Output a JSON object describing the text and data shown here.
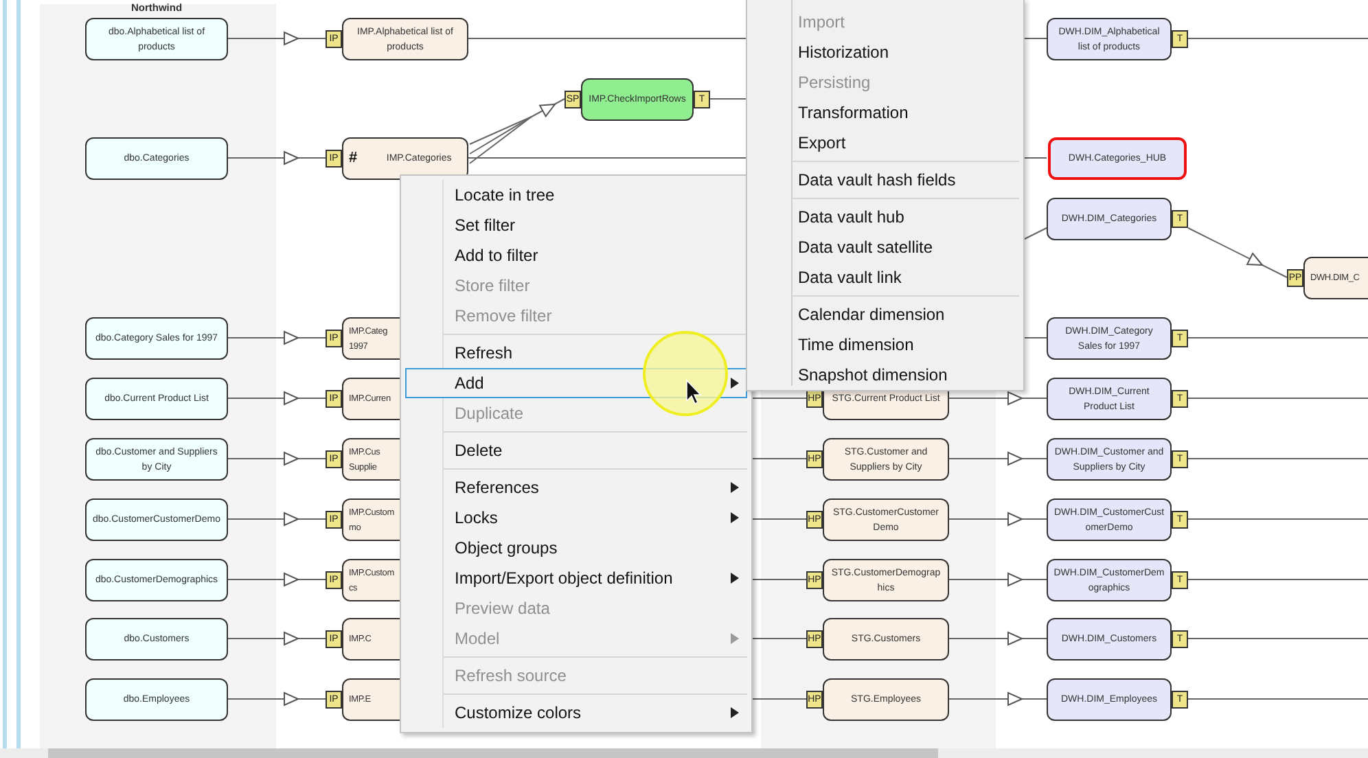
{
  "diagram": {
    "group_label": "Northwind",
    "rows": [
      {
        "source": {
          "label": "dbo.Alphabetical list of products"
        },
        "import": {
          "badge": "IP",
          "label": "IMP.Alphabetical list of products"
        },
        "dwh": {
          "label": "DWH.DIM_Alphabetical list of products",
          "badge": "T",
          "highlighted": false
        }
      },
      {
        "source": {
          "label": "dbo.Categories"
        },
        "import": {
          "badge": "IP",
          "prefix": "#",
          "label": "IMP.Categories"
        },
        "dwh": {
          "label": "DWH.Categories_HUB",
          "highlighted": true
        }
      },
      {
        "dwh": {
          "label": "DWH.DIM_Categories",
          "badge": "T",
          "highlighted": false
        }
      },
      {
        "source": {
          "label": "dbo.Category Sales for 1997"
        },
        "import": {
          "badge": "IP",
          "label": "IMP.Categ\n1997"
        },
        "dwh": {
          "label": "DWH.DIM_Category Sales for 1997",
          "badge": "T",
          "highlighted": false
        }
      },
      {
        "source": {
          "label": "dbo.Current Product List"
        },
        "import": {
          "badge": "IP",
          "label": "IMP.Curren"
        },
        "stage": {
          "badge": "HP",
          "label": "STG.Current Product List"
        },
        "dwh": {
          "label": "DWH.DIM_Current Product List",
          "badge": "T",
          "highlighted": false
        }
      },
      {
        "source": {
          "label": "dbo.Customer and Suppliers by City"
        },
        "import": {
          "badge": "IP",
          "label": "IMP.Cus\nSupplie"
        },
        "stage": {
          "badge": "HP",
          "label": "STG.Customer and Suppliers by City"
        },
        "dwh": {
          "label": "DWH.DIM_Customer and Suppliers by City",
          "badge": "T",
          "highlighted": false
        }
      },
      {
        "source": {
          "label": "dbo.CustomerCustomerDemo"
        },
        "import": {
          "badge": "IP",
          "label": "IMP.Custom\nmo"
        },
        "stage": {
          "badge": "HP",
          "label": "STG.CustomerCustomerDemo"
        },
        "dwh": {
          "label": "DWH.DIM_CustomerCustomerDemo",
          "badge": "T",
          "highlighted": false
        }
      },
      {
        "source": {
          "label": "dbo.CustomerDemographics"
        },
        "import": {
          "badge": "IP",
          "label": "IMP.Custom\ncs"
        },
        "stage": {
          "badge": "HP",
          "label": "STG.CustomerDemographics"
        },
        "dwh": {
          "label": "DWH.DIM_CustomerDemographics",
          "badge": "T",
          "highlighted": false
        }
      },
      {
        "source": {
          "label": "dbo.Customers"
        },
        "import": {
          "badge": "IP",
          "label": "IMP.C"
        },
        "stage": {
          "badge": "HP",
          "label": "STG.Customers"
        },
        "dwh": {
          "label": "DWH.DIM_Customers",
          "badge": "T",
          "highlighted": false
        }
      },
      {
        "source": {
          "label": "dbo.Employees"
        },
        "import": {
          "badge": "IP",
          "label": "IMP.E"
        },
        "stage": {
          "badge": "HP",
          "label": "STG.Employees"
        },
        "dwh": {
          "label": "DWH.DIM_Employees",
          "badge": "T",
          "highlighted": false
        }
      }
    ],
    "check_rows": {
      "label": "IMP.CheckImportRows",
      "badges": [
        "SP",
        "T"
      ]
    },
    "downstream": {
      "badge": "PP",
      "label": "DWH.DIM_C"
    }
  },
  "context_menu": {
    "items": [
      {
        "kind": "item",
        "label": "Locate in tree",
        "disabled": false,
        "submenu": false,
        "selected": false
      },
      {
        "kind": "item",
        "label": "Set filter",
        "disabled": false,
        "submenu": false,
        "selected": false
      },
      {
        "kind": "item",
        "label": "Add to filter",
        "disabled": false,
        "submenu": false,
        "selected": false
      },
      {
        "kind": "item",
        "label": "Store filter",
        "disabled": true,
        "submenu": false,
        "selected": false
      },
      {
        "kind": "item",
        "label": "Remove filter",
        "disabled": true,
        "submenu": false,
        "selected": false
      },
      {
        "kind": "separator"
      },
      {
        "kind": "item",
        "label": "Refresh",
        "disabled": false,
        "submenu": false,
        "selected": false
      },
      {
        "kind": "item",
        "label": "Add",
        "disabled": false,
        "submenu": true,
        "selected": true
      },
      {
        "kind": "item",
        "label": "Duplicate",
        "disabled": true,
        "submenu": false,
        "selected": false
      },
      {
        "kind": "separator"
      },
      {
        "kind": "item",
        "label": "Delete",
        "disabled": false,
        "submenu": false,
        "selected": false
      },
      {
        "kind": "separator"
      },
      {
        "kind": "item",
        "label": "References",
        "disabled": false,
        "submenu": true,
        "selected": false
      },
      {
        "kind": "item",
        "label": "Locks",
        "disabled": false,
        "submenu": true,
        "selected": false
      },
      {
        "kind": "item",
        "label": "Object groups",
        "disabled": false,
        "submenu": false,
        "selected": false
      },
      {
        "kind": "item",
        "label": "Import/Export object definition",
        "disabled": false,
        "submenu": true,
        "selected": false
      },
      {
        "kind": "item",
        "label": "Preview data",
        "disabled": true,
        "submenu": false,
        "selected": false
      },
      {
        "kind": "item",
        "label": "Model",
        "disabled": true,
        "submenu": true,
        "selected": false
      },
      {
        "kind": "separator"
      },
      {
        "kind": "item",
        "label": "Refresh source",
        "disabled": true,
        "submenu": false,
        "selected": false
      },
      {
        "kind": "separator"
      },
      {
        "kind": "item",
        "label": "Customize colors",
        "disabled": false,
        "submenu": true,
        "selected": false
      }
    ]
  },
  "submenu": {
    "items": [
      {
        "kind": "item",
        "label": "Import",
        "disabled": true,
        "selected": false
      },
      {
        "kind": "item",
        "label": "Historization",
        "disabled": false,
        "selected": false
      },
      {
        "kind": "item",
        "label": "Persisting",
        "disabled": true,
        "selected": false
      },
      {
        "kind": "item",
        "label": "Transformation",
        "disabled": false,
        "selected": false
      },
      {
        "kind": "item",
        "label": "Export",
        "disabled": false,
        "selected": false
      },
      {
        "kind": "separator"
      },
      {
        "kind": "item",
        "label": "Data vault hash fields",
        "disabled": false,
        "selected": false
      },
      {
        "kind": "separator"
      },
      {
        "kind": "item",
        "label": "Data vault hub",
        "disabled": false,
        "selected": false
      },
      {
        "kind": "item",
        "label": "Data vault satellite",
        "disabled": false,
        "selected": false
      },
      {
        "kind": "item",
        "label": "Data vault link",
        "disabled": false,
        "selected": false
      },
      {
        "kind": "separator"
      },
      {
        "kind": "item",
        "label": "Calendar dimension",
        "disabled": false,
        "selected": false
      },
      {
        "kind": "item",
        "label": "Time dimension",
        "disabled": false,
        "selected": false
      },
      {
        "kind": "item",
        "label": "Snapshot dimension",
        "disabled": false,
        "selected": false
      }
    ]
  }
}
